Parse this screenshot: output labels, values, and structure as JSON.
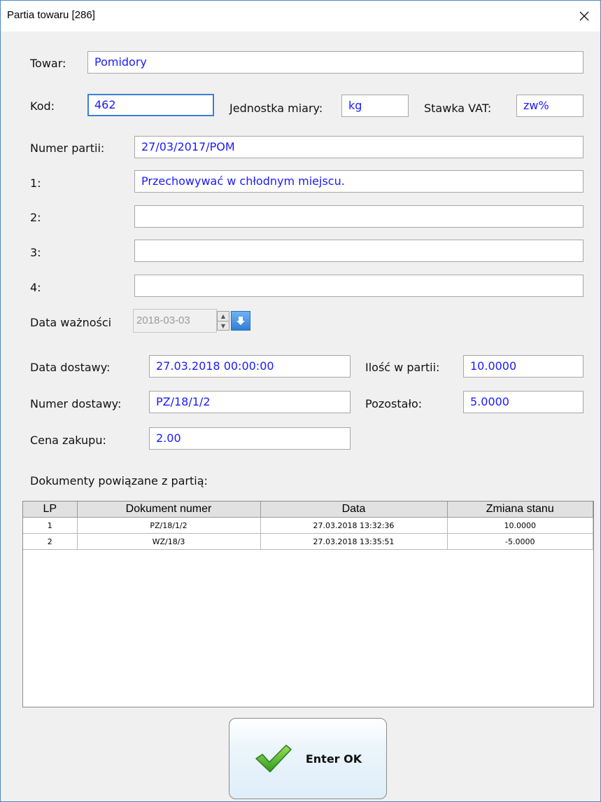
{
  "window": {
    "title": "Partia towaru [286]"
  },
  "form": {
    "towar_label": "Towar:",
    "towar_value": "Pomidory",
    "kod_label": "Kod:",
    "kod_value": "462",
    "jm_label": "Jednostka miary:",
    "jm_value": "kg",
    "vat_label": "Stawka VAT:",
    "vat_value": "zw%",
    "numer_partii_label": "Numer partii:",
    "numer_partii_value": "27/03/2017/POM",
    "l1_label": "1:",
    "l1_value": "Przechowywać w chłodnym miejscu.",
    "l2_label": "2:",
    "l2_value": "",
    "l3_label": "3:",
    "l3_value": "",
    "l4_label": "4:",
    "l4_value": "",
    "data_waznosci_label": "Data ważności",
    "data_waznosci_value": "2018-03-03",
    "data_dostawy_label": "Data dostawy:",
    "data_dostawy_value": "27.03.2018 00:00:00",
    "ilosc_label": "Ilość w partii:",
    "ilosc_value": "10.0000",
    "numer_dostawy_label": "Numer dostawy:",
    "numer_dostawy_value": "PZ/18/1/2",
    "pozostalo_label": "Pozostało:",
    "pozostalo_value": "5.0000",
    "cena_label": "Cena zakupu:",
    "cena_value": "2.00",
    "docs_label": "Dokumenty powiązane z partią:"
  },
  "table": {
    "columns": [
      "LP",
      "Dokument numer",
      "Data",
      "Zmiana stanu"
    ],
    "rows": [
      [
        "1",
        "PZ/18/1/2",
        "27.03.2018 13:32:36",
        "10.0000"
      ],
      [
        "2",
        "WZ/18/3",
        "27.03.2018 13:35:51",
        "-5.0000"
      ]
    ]
  },
  "ok_button": {
    "label": "Enter OK"
  },
  "colors": {
    "value_text": "#1a1aff",
    "focus_border": "#3c7fd6",
    "window_border": "#4a88c9"
  },
  "icons": {
    "close": "close-icon",
    "ok": "checkmark-icon",
    "dropdown": "calendar-dropdown-icon"
  }
}
